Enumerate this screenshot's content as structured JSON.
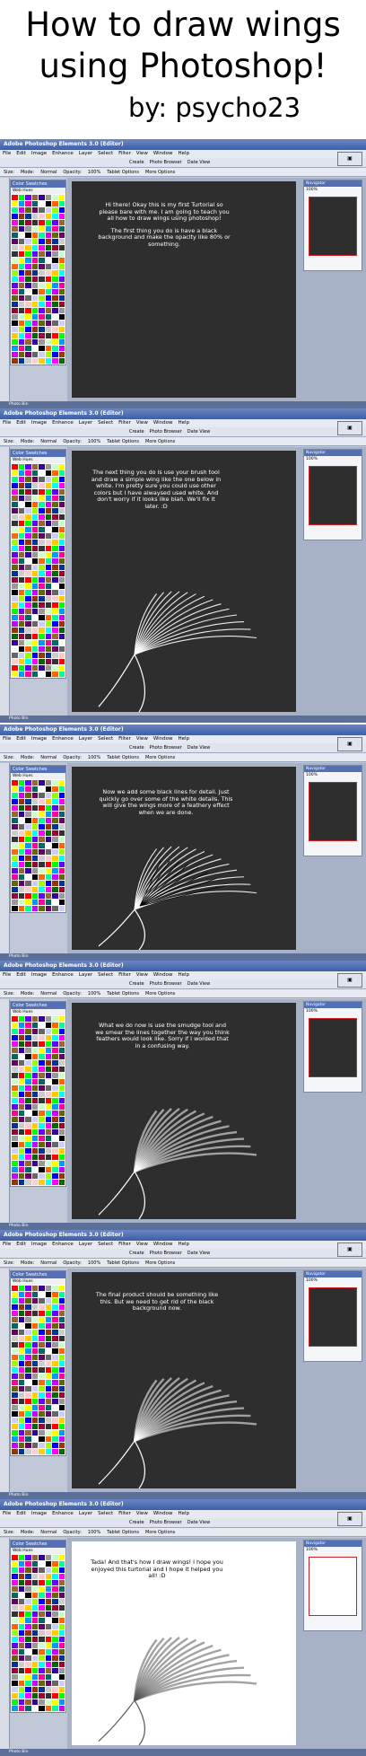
{
  "header": {
    "title_line1": "How to draw wings",
    "title_line2": "using Photoshop!",
    "author": "by: psycho23"
  },
  "app": {
    "name": "Adobe Photoshop Elements 3.0 (Editor)",
    "menu": [
      "File",
      "Edit",
      "Image",
      "Enhance",
      "Layer",
      "Select",
      "Filter",
      "View",
      "Window",
      "Help"
    ],
    "toolbar": [
      "Create",
      "Photo Browser",
      "Date View"
    ],
    "options": [
      "Size:",
      "Mode:",
      "Normal",
      "Opacity:",
      "100%",
      "Tablet Options",
      "More Options"
    ],
    "swatches_title": "Color Swatches",
    "swatches_subtitle": "Web Hues",
    "navigator_title": "Navigator",
    "zoom": "100%",
    "photo_bin": "Photo Bin"
  },
  "steps": [
    {
      "paragraphs": [
        "Hi there! Okay this is my first Turtorial so please bare with me. I am going to teach you all how to draw wings using photoshop!",
        "The first thing you do is have a black background and make the opacity like 80% or something."
      ]
    },
    {
      "paragraphs": [
        "The next thing you do is use your brush tool and draw a simple wing like the one below in white. I'm pretty sure you could use other colors but I have alwaysed used white. And don't worry if it looks like blah. We'll fix it later. :D"
      ]
    },
    {
      "paragraphs": [
        "Now we add some black lines for detail. Just quickly go over some of the white details. This will give the wings more of a feathery effect when we are done."
      ]
    },
    {
      "paragraphs": [
        "What we do now is use the smudge tool and we smear the lines together the way you think feathers would look like. Sorry if I worded that in a confusing way."
      ]
    },
    {
      "paragraphs": [
        "The final product should be something like this. But we need to get rid of the black background now."
      ]
    },
    {
      "paragraphs": [
        "Tada! And that's how I draw wings! I hope you enjoyed this turtorial and I hope it helped you all! :D"
      ]
    }
  ],
  "colors": {
    "canvas_dark": "#2e2e2e",
    "canvas_light": "#ffffff",
    "titlebar": "#3d5ea6"
  }
}
